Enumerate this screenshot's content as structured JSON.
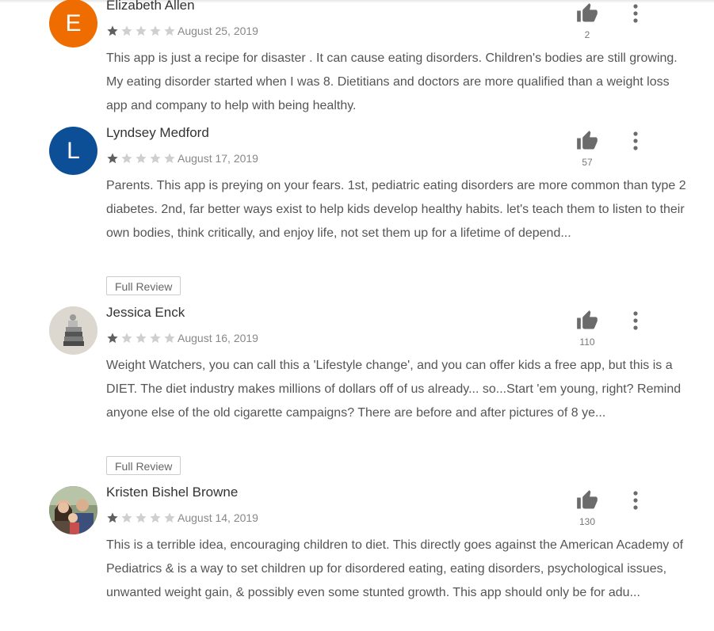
{
  "reviews": [
    {
      "name": "Elizabeth Allen",
      "avatar_letter": "E",
      "avatar_color": "#ef6c00",
      "rating": 1,
      "date": "August 25, 2019",
      "helpful_count": "2",
      "text": "This app is just a recipe for disaster . It can cause eating disorders. Children's bodies are still growing. My eating disorder started when I was 8. Dietitians and doctors are more qualified than a weight loss app and company to help with being healthy.",
      "full_review_label": null
    },
    {
      "name": "Lyndsey Medford",
      "avatar_letter": "L",
      "avatar_color": "#0d4f97",
      "rating": 1,
      "date": "August 17, 2019",
      "helpful_count": "57",
      "text": "Parents. This app is preying on your fears. 1st, pediatric eating disorders are more common than type 2 diabetes. 2nd, far better ways exist to help kids develop healthy habits. let's teach them to listen to their own bodies, think critically, and enjoy life, not set them up for a lifetime of depend...",
      "full_review_label": "Full Review"
    },
    {
      "name": "Jessica Enck",
      "avatar_letter": "",
      "avatar_color": "#d9d4cb",
      "rating": 1,
      "date": "August 16, 2019",
      "helpful_count": "110",
      "text": "Weight Watchers, you can call this a 'Lifestyle change', and you can offer kids a free app, but this is a DIET. The diet industry makes millions of dollars off of us already... so...Start 'em young, right? Remind anyone else of the old cigarette campaigns? There are before and after pictures of 8 ye...",
      "full_review_label": "Full Review"
    },
    {
      "name": "Kristen Bishel Browne",
      "avatar_letter": "",
      "avatar_color": "#7b6a5a",
      "rating": 1,
      "date": "August 14, 2019",
      "helpful_count": "130",
      "text": "This is a terrible idea, encouraging children to diet. This directly goes against the American Academy of Pediatrics & is a way to set children up for disordered eating, eating disorders, psychological issues, unwanted weight gain, & possibly even some stunted growth. This app should only be for adu...",
      "full_review_label": null
    }
  ],
  "colors": {
    "star_filled": "#5f5f5f",
    "star_empty": "#cfcfcf",
    "icon": "#6b6b6b"
  },
  "icons": {
    "helpful": "thumbs-up-icon",
    "more": "more-vertical-icon",
    "star": "star-icon"
  }
}
